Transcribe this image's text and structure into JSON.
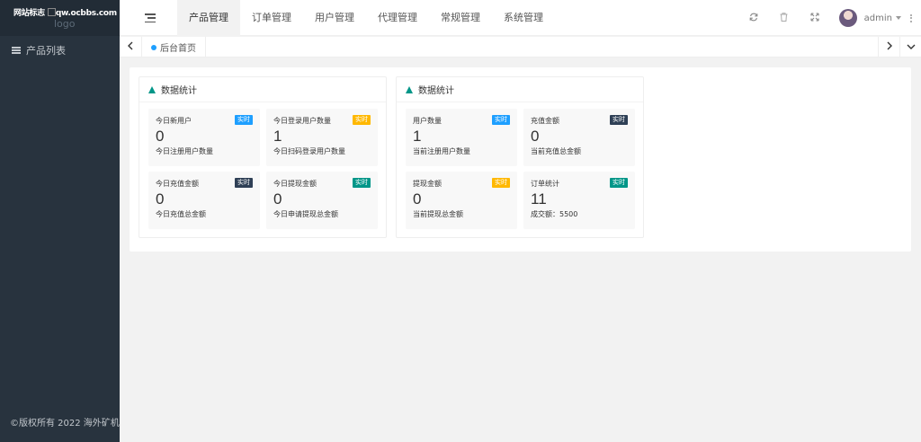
{
  "sidebar": {
    "logo_text": "网站标志",
    "logo_link_text": "qw.ocbbs.com",
    "logo_sub": "logo",
    "items": [
      {
        "label": "产品列表"
      }
    ],
    "copyright": "©版权所有 2022 海外矿机"
  },
  "header": {
    "nav": [
      {
        "label": "产品管理",
        "active": true
      },
      {
        "label": "订单管理"
      },
      {
        "label": "用户管理"
      },
      {
        "label": "代理管理"
      },
      {
        "label": "常规管理"
      },
      {
        "label": "系统管理"
      }
    ],
    "username": "admin"
  },
  "tabs": {
    "home_label": "后台首页"
  },
  "panels": [
    {
      "title": "数据统计",
      "cards": [
        {
          "title": "今日新用户",
          "badge": "实时",
          "badge_color": "#1e9fff",
          "value": "0",
          "desc": "今日注册用户数量"
        },
        {
          "title": "今日登录用户数量",
          "badge": "实时",
          "badge_color": "#ffb800",
          "value": "1",
          "desc": "今日扫码登录用户数量"
        },
        {
          "title": "今日充值金额",
          "badge": "实时",
          "badge_color": "#2f4056",
          "value": "0",
          "desc": "今日充值总金额"
        },
        {
          "title": "今日提现金额",
          "badge": "实时",
          "badge_color": "#009688",
          "value": "0",
          "desc": "今日申请提现总金额"
        }
      ]
    },
    {
      "title": "数据统计",
      "cards": [
        {
          "title": "用户数量",
          "badge": "实时",
          "badge_color": "#1e9fff",
          "value": "1",
          "desc": "当前注册用户数量"
        },
        {
          "title": "充值金额",
          "badge": "实时",
          "badge_color": "#2f4056",
          "value": "0",
          "desc": "当前充值总金额"
        },
        {
          "title": "提现金额",
          "badge": "实时",
          "badge_color": "#ffb800",
          "value": "0",
          "desc": "当前提现总金额"
        },
        {
          "title": "订单统计",
          "badge": "实时",
          "badge_color": "#009688",
          "value": "11",
          "desc": "成交额：5500"
        }
      ]
    }
  ]
}
